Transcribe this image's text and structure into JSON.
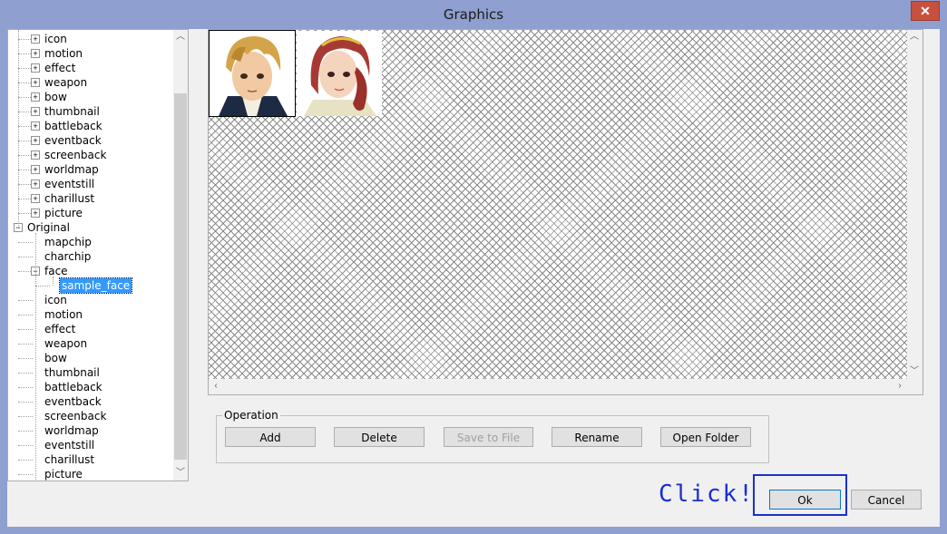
{
  "window": {
    "title": "Graphics",
    "close_glyph": "✕"
  },
  "tree": {
    "items": [
      {
        "label": "icon",
        "level": 1,
        "expander": "+"
      },
      {
        "label": "motion",
        "level": 1,
        "expander": "+"
      },
      {
        "label": "effect",
        "level": 1,
        "expander": "+"
      },
      {
        "label": "weapon",
        "level": 1,
        "expander": "+"
      },
      {
        "label": "bow",
        "level": 1,
        "expander": "+"
      },
      {
        "label": "thumbnail",
        "level": 1,
        "expander": "+"
      },
      {
        "label": "battleback",
        "level": 1,
        "expander": "+"
      },
      {
        "label": "eventback",
        "level": 1,
        "expander": "+"
      },
      {
        "label": "screenback",
        "level": 1,
        "expander": "+"
      },
      {
        "label": "worldmap",
        "level": 1,
        "expander": "+"
      },
      {
        "label": "eventstill",
        "level": 1,
        "expander": "+"
      },
      {
        "label": "charillust",
        "level": 1,
        "expander": "+"
      },
      {
        "label": "picture",
        "level": 1,
        "expander": "+"
      },
      {
        "label": "Original",
        "level": 0,
        "expander": "−"
      },
      {
        "label": "mapchip",
        "level": 1,
        "expander": ""
      },
      {
        "label": "charchip",
        "level": 1,
        "expander": ""
      },
      {
        "label": "face",
        "level": 1,
        "expander": "−"
      },
      {
        "label": "sample_face",
        "level": 2,
        "expander": "",
        "selected": true
      },
      {
        "label": "icon",
        "level": 1,
        "expander": ""
      },
      {
        "label": "motion",
        "level": 1,
        "expander": ""
      },
      {
        "label": "effect",
        "level": 1,
        "expander": ""
      },
      {
        "label": "weapon",
        "level": 1,
        "expander": ""
      },
      {
        "label": "bow",
        "level": 1,
        "expander": ""
      },
      {
        "label": "thumbnail",
        "level": 1,
        "expander": ""
      },
      {
        "label": "battleback",
        "level": 1,
        "expander": ""
      },
      {
        "label": "eventback",
        "level": 1,
        "expander": ""
      },
      {
        "label": "screenback",
        "level": 1,
        "expander": ""
      },
      {
        "label": "worldmap",
        "level": 1,
        "expander": ""
      },
      {
        "label": "eventstill",
        "level": 1,
        "expander": ""
      },
      {
        "label": "charillust",
        "level": 1,
        "expander": ""
      },
      {
        "label": "picture",
        "level": 1,
        "expander": ""
      }
    ]
  },
  "preview": {
    "faces": [
      {
        "name": "male-face",
        "selected": true
      },
      {
        "name": "female-face",
        "selected": false
      }
    ]
  },
  "operation": {
    "label": "Operation",
    "buttons": [
      {
        "label": "Add",
        "enabled": true
      },
      {
        "label": "Delete",
        "enabled": true
      },
      {
        "label": "Save to File",
        "enabled": false
      },
      {
        "label": "Rename",
        "enabled": true
      },
      {
        "label": "Open Folder",
        "enabled": true
      }
    ]
  },
  "dialog": {
    "ok_label": "Ok",
    "cancel_label": "Cancel"
  },
  "annotation": {
    "text": "Click!",
    "color": "#1a2fd0"
  }
}
